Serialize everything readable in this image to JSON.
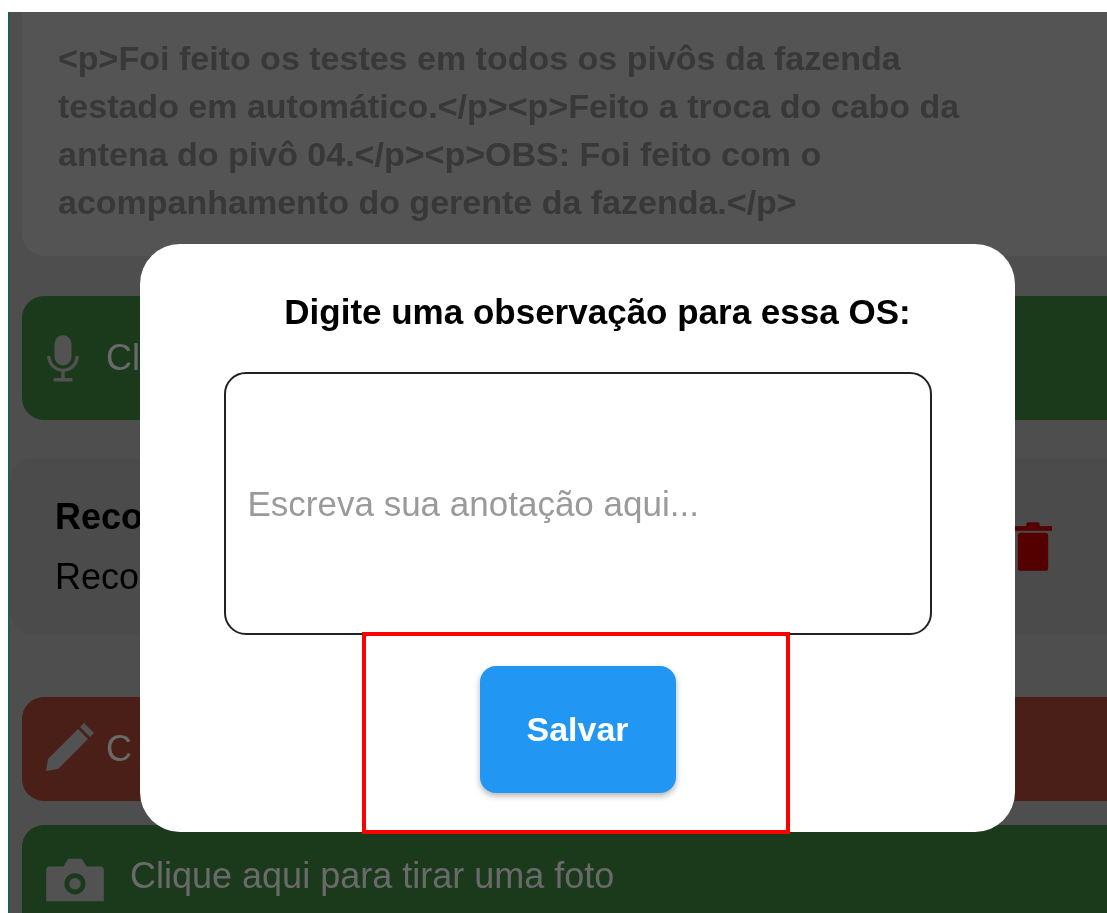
{
  "description_card": {
    "text": "<p>Foi feito os testes em todos os pivôs da fazenda testado em automático.</p><p>Feito a troca do cabo da antena do pivô 04.</p><p>OBS: Foi feito com o acompanhamento do gerente da fazenda.</p>"
  },
  "record_audio_button": {
    "label": "Cl"
  },
  "recording": {
    "title": "Reco",
    "subtitle": "Reco"
  },
  "edit_button": {
    "label": "C"
  },
  "photo_button": {
    "label": "Clique aqui para tirar uma foto"
  },
  "dialog": {
    "title": "Digite uma observação para essa OS:",
    "note": {
      "placeholder": "Escreva sua anotação aqui..."
    },
    "save_button": "Salvar"
  }
}
